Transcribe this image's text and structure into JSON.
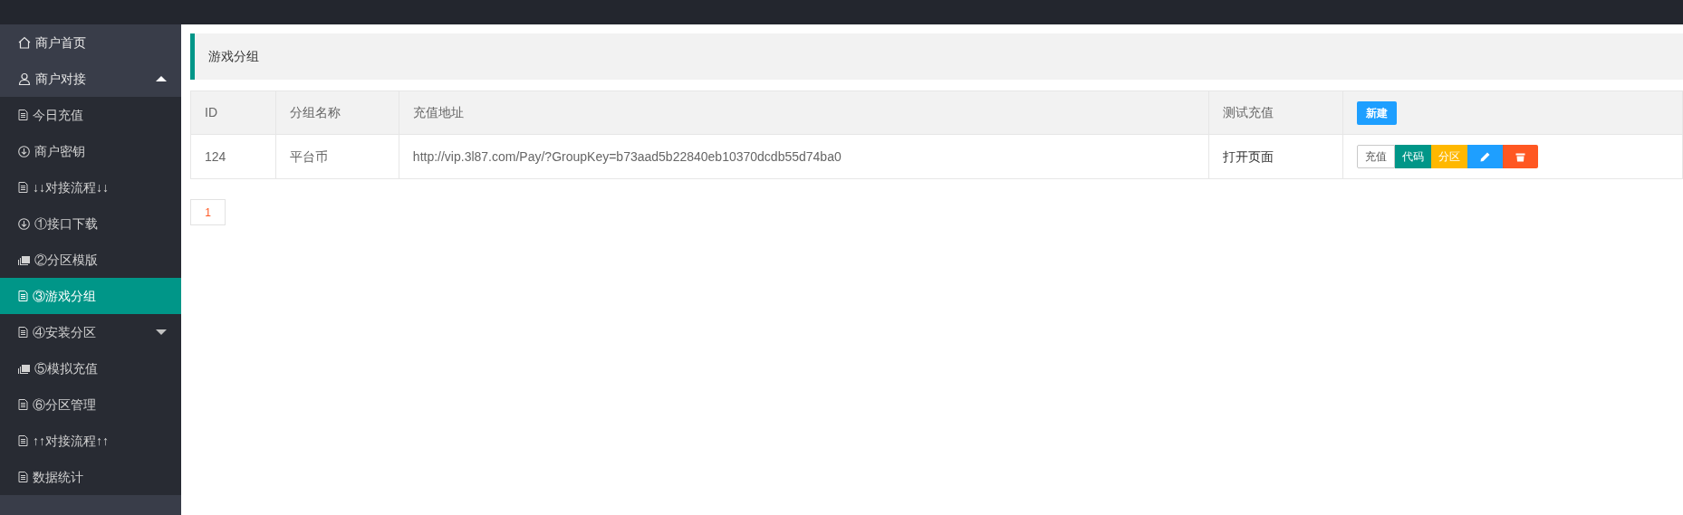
{
  "sidebar": {
    "items": [
      {
        "label": "商户首页",
        "kind": "home",
        "selected": false
      },
      {
        "label": "商户对接",
        "kind": "user",
        "selected": false,
        "expanded": true,
        "children": [
          {
            "label": "今日充值",
            "kind": "page",
            "selected": false
          },
          {
            "label": "商户密钥",
            "kind": "download",
            "selected": false
          },
          {
            "label": "↓↓对接流程↓↓",
            "kind": "page",
            "selected": false
          },
          {
            "label": "①接口下载",
            "kind": "download",
            "selected": false
          },
          {
            "label": "②分区模版",
            "kind": "cards",
            "selected": false
          },
          {
            "label": "③游戏分组",
            "kind": "page",
            "selected": true
          },
          {
            "label": "④安装分区",
            "kind": "page",
            "selected": false,
            "expanded": false
          },
          {
            "label": "⑤模拟充值",
            "kind": "cards",
            "selected": false
          },
          {
            "label": "⑥分区管理",
            "kind": "page",
            "selected": false
          },
          {
            "label": "↑↑对接流程↑↑",
            "kind": "page",
            "selected": false
          },
          {
            "label": "数据统计",
            "kind": "page",
            "selected": false
          }
        ]
      }
    ]
  },
  "page_title": "游戏分组",
  "table": {
    "columns": [
      "ID",
      "分组名称",
      "充值地址",
      "测试充值"
    ],
    "new_button": "新建",
    "rows": [
      {
        "cells": [
          "124",
          "平台币",
          "http://vip.3l87.com/Pay/?GroupKey=b73aad5b22840eb10370dcdb55d74ba0",
          "打开页面"
        ],
        "actions": [
          {
            "kind": "outline",
            "label": "充值"
          },
          {
            "kind": "teal",
            "label": "代码"
          },
          {
            "kind": "yellow",
            "label": "分区"
          },
          {
            "kind": "edit"
          },
          {
            "kind": "delete"
          }
        ]
      }
    ]
  },
  "pagination": [
    {
      "label": "1",
      "selected": true
    }
  ]
}
